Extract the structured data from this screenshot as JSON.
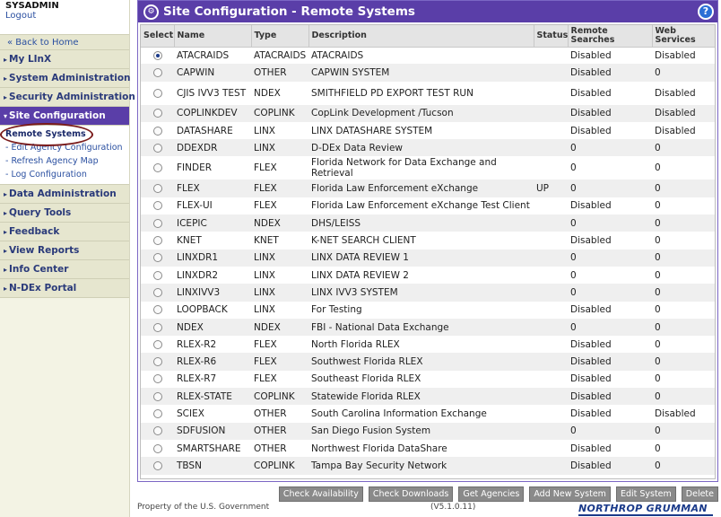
{
  "user": {
    "name": "SYSADMIN",
    "logout": "Logout"
  },
  "nav": {
    "back": "« Back to Home",
    "sections": [
      {
        "label": "My LInX"
      },
      {
        "label": "System Administration"
      },
      {
        "label": "Security Administration"
      },
      {
        "label": "Site Configuration"
      },
      {
        "label": "Data Administration"
      },
      {
        "label": "Query Tools"
      },
      {
        "label": "Feedback"
      },
      {
        "label": "View Reports"
      },
      {
        "label": "Info Center"
      },
      {
        "label": "N-DEx Portal"
      }
    ],
    "site_config_items": [
      {
        "label": "Remote Systems"
      },
      {
        "label": "Edit Agency Configuration"
      },
      {
        "label": "Refresh Agency Map"
      },
      {
        "label": "Log Configuration"
      }
    ]
  },
  "panel": {
    "title": "Site Configuration - Remote Systems",
    "help": "?"
  },
  "table": {
    "headers": {
      "select": "Select",
      "name": "Name",
      "type": "Type",
      "description": "Description",
      "status": "Status",
      "remote": "Remote Searches",
      "web": "Web Services"
    },
    "rows": [
      {
        "selected": true,
        "name": "ATACRAIDS",
        "type": "ATACRAIDS",
        "description": "ATACRAIDS",
        "status": "",
        "remote": "Disabled",
        "web": "Disabled"
      },
      {
        "selected": false,
        "name": "CAPWIN",
        "type": "OTHER",
        "description": "CAPWIN SYSTEM",
        "status": "",
        "remote": "Disabled",
        "web": "0"
      },
      {
        "selected": false,
        "name": "CJIS IVV3 TEST",
        "type": "NDEX",
        "description": "SMITHFIELD PD EXPORT TEST RUN",
        "status": "",
        "remote": "Disabled",
        "web": "Disabled"
      },
      {
        "selected": false,
        "name": "COPLINKDEV",
        "type": "COPLINK",
        "description": "CopLink Development /Tucson",
        "status": "",
        "remote": "Disabled",
        "web": "Disabled"
      },
      {
        "selected": false,
        "name": "DATASHARE",
        "type": "LINX",
        "description": "LINX DATASHARE SYSTEM",
        "status": "",
        "remote": "Disabled",
        "web": "Disabled"
      },
      {
        "selected": false,
        "name": "DDEXDR",
        "type": "LINX",
        "description": "D-DEx Data Review",
        "status": "",
        "remote": "0",
        "web": "0"
      },
      {
        "selected": false,
        "name": "FINDER",
        "type": "FLEX",
        "description": "Florida Network for Data Exchange and Retrieval",
        "status": "",
        "remote": "0",
        "web": "0"
      },
      {
        "selected": false,
        "name": "FLEX",
        "type": "FLEX",
        "description": "Florida Law Enforcement eXchange",
        "status": "UP",
        "remote": "0",
        "web": "0"
      },
      {
        "selected": false,
        "name": "FLEX-UI",
        "type": "FLEX",
        "description": "Florida Law Enforcement eXchange Test Client",
        "status": "",
        "remote": "Disabled",
        "web": "0"
      },
      {
        "selected": false,
        "name": "ICEPIC",
        "type": "NDEX",
        "description": "DHS/LEISS",
        "status": "",
        "remote": "0",
        "web": "0"
      },
      {
        "selected": false,
        "name": "KNET",
        "type": "KNET",
        "description": "K-NET SEARCH CLIENT",
        "status": "",
        "remote": "Disabled",
        "web": "0"
      },
      {
        "selected": false,
        "name": "LINXDR1",
        "type": "LINX",
        "description": "LINX DATA REVIEW 1",
        "status": "",
        "remote": "0",
        "web": "0"
      },
      {
        "selected": false,
        "name": "LINXDR2",
        "type": "LINX",
        "description": "LINX DATA REVIEW 2",
        "status": "",
        "remote": "0",
        "web": "0"
      },
      {
        "selected": false,
        "name": "LINXIVV3",
        "type": "LINX",
        "description": "LINX IVV3 SYSTEM",
        "status": "",
        "remote": "0",
        "web": "0"
      },
      {
        "selected": false,
        "name": "LOOPBACK",
        "type": "LINX",
        "description": "For Testing",
        "status": "",
        "remote": "Disabled",
        "web": "0"
      },
      {
        "selected": false,
        "name": "NDEX",
        "type": "NDEX",
        "description": "FBI - National Data Exchange",
        "status": "",
        "remote": "0",
        "web": "0"
      },
      {
        "selected": false,
        "name": "RLEX-R2",
        "type": "FLEX",
        "description": "North Florida RLEX",
        "status": "",
        "remote": "Disabled",
        "web": "0"
      },
      {
        "selected": false,
        "name": "RLEX-R6",
        "type": "FLEX",
        "description": "Southwest Florida RLEX",
        "status": "",
        "remote": "Disabled",
        "web": "0"
      },
      {
        "selected": false,
        "name": "RLEX-R7",
        "type": "FLEX",
        "description": "Southeast Florida RLEX",
        "status": "",
        "remote": "Disabled",
        "web": "0"
      },
      {
        "selected": false,
        "name": "RLEX-STATE",
        "type": "COPLINK",
        "description": "Statewide Florida RLEX",
        "status": "",
        "remote": "Disabled",
        "web": "0"
      },
      {
        "selected": false,
        "name": "SCIEX",
        "type": "OTHER",
        "description": "South Carolina Information Exchange",
        "status": "",
        "remote": "Disabled",
        "web": "Disabled"
      },
      {
        "selected": false,
        "name": "SDFUSION",
        "type": "OTHER",
        "description": "San Diego Fusion System",
        "status": "",
        "remote": "0",
        "web": "0"
      },
      {
        "selected": false,
        "name": "SMARTSHARE",
        "type": "OTHER",
        "description": "Northwest Florida DataShare",
        "status": "",
        "remote": "Disabled",
        "web": "0"
      },
      {
        "selected": false,
        "name": "TBSN",
        "type": "COPLINK",
        "description": "Tampa Bay Security Network",
        "status": "",
        "remote": "Disabled",
        "web": "0"
      }
    ]
  },
  "buttons": [
    {
      "label": "Check Availability"
    },
    {
      "label": "Check Downloads"
    },
    {
      "label": "Get Agencies"
    },
    {
      "label": "Add New System"
    },
    {
      "label": "Edit System"
    },
    {
      "label": "Delete"
    }
  ],
  "footer": {
    "property": "Property of the U.S. Government",
    "version": "(V5.1.0.11)",
    "logo": "NORTHROP GRUMMAN"
  }
}
